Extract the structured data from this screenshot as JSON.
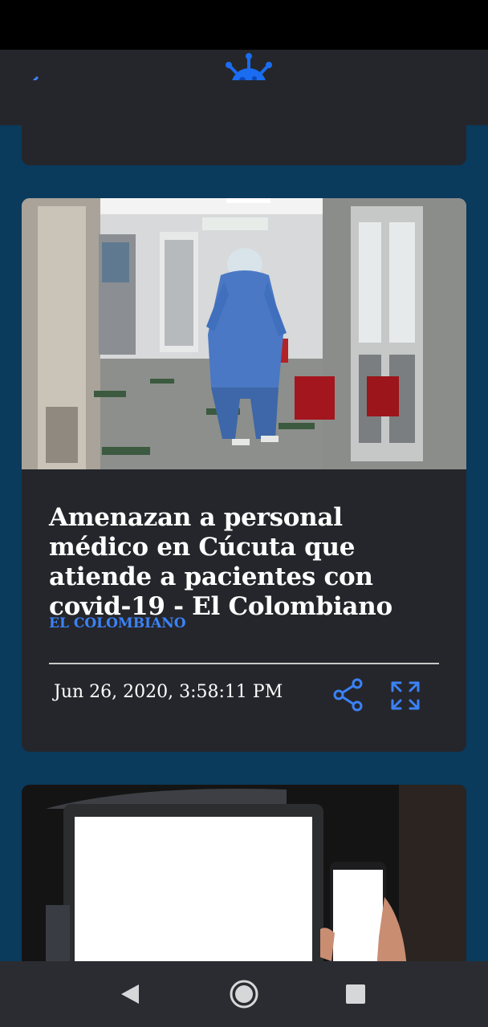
{
  "app": {
    "back_icon": "arrow-left-icon",
    "logo_icon": "virus-icon",
    "accent_color": "#3b82f6"
  },
  "article": {
    "headline": "Amenazan a personal médico en Cúcuta que atiende a pacientes con covid-19 - El Colombiano",
    "source": "EL COLOMBIANO",
    "timestamp": "Jun 26, 2020, 3:58:11 PM",
    "share_icon": "share-icon",
    "expand_icon": "expand-icon"
  },
  "colors": {
    "background": "#0a3a5c",
    "card": "#25262b",
    "text": "#ffffff",
    "source": "#3b82f6"
  },
  "nav": {
    "back_icon": "triangle-back-icon",
    "home_icon": "circle-home-icon",
    "recents_icon": "square-recents-icon"
  }
}
